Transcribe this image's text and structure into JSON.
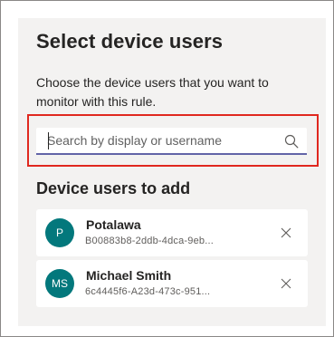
{
  "panel": {
    "title": "Select device users",
    "description": "Choose the device users that you want to monitor with this rule."
  },
  "search": {
    "placeholder": "Search by display or username",
    "value": "",
    "icon": "search-icon"
  },
  "section": {
    "title": "Device users to add"
  },
  "users": [
    {
      "initials": "P",
      "name": "Potalawa",
      "id": "B00883b8-2ddb-4dca-9eb...",
      "remove_icon": "close-icon"
    },
    {
      "initials": "MS",
      "name": "Michael Smith",
      "id": "6c4445f6-A23d-473c-951...",
      "remove_icon": "close-icon"
    }
  ],
  "colors": {
    "accent": "#6264a7",
    "highlight": "#e0281f",
    "avatar": "#03787c",
    "panel_background": "#f3f2f1"
  }
}
